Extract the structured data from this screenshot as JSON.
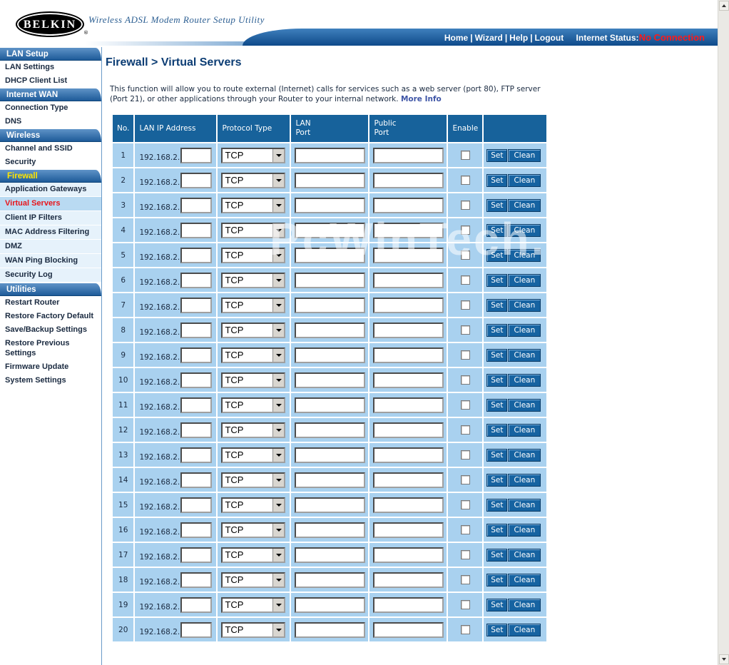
{
  "header": {
    "logo_text": "BELKIN",
    "logo_reg": "®",
    "utility_title": "Wireless ADSL Modem Router Setup Utility",
    "nav": [
      "Home",
      "Wizard",
      "Help",
      "Logout"
    ],
    "nav_separator": "|",
    "status_label": "Internet Status:",
    "status_value": "No Connection",
    "status_color": "#ff1a1a"
  },
  "sidebar": {
    "sections": [
      {
        "title": "LAN Setup",
        "items": [
          "LAN Settings",
          "DHCP Client List"
        ]
      },
      {
        "title": "Internet WAN",
        "items": [
          "Connection Type",
          "DNS"
        ]
      },
      {
        "title": "Wireless",
        "items": [
          "Channel and SSID",
          "Security"
        ]
      },
      {
        "title": "Firewall",
        "items": [
          "Application Gateways",
          "Virtual Servers",
          "Client IP Filters",
          "MAC Address Filtering",
          "DMZ",
          "WAN Ping Blocking",
          "Security Log"
        ]
      },
      {
        "title": "Utilities",
        "items": [
          "Restart Router",
          "Restore Factory Default",
          "Save/Backup Settings",
          "Restore Previous Settings",
          "Firmware Update",
          "System Settings"
        ]
      }
    ],
    "active_section": "Firewall",
    "active_item": "Virtual Servers"
  },
  "main": {
    "title": "Firewall > Virtual Servers",
    "intro": "This function will allow you to route external (Internet) calls for services such as a web server (port 80), FTP server (Port 21), or other applications through your Router to your internal network.",
    "more_info": "More Info",
    "table": {
      "headers": {
        "no": "No.",
        "lan_ip": "LAN IP Address",
        "protocol": "Protocol Type",
        "lan_port_1": "LAN",
        "lan_port_2": "Port",
        "public_port_1": "Public",
        "public_port_2": "Port",
        "enable": "Enable"
      },
      "ip_prefix": "192.168.2.",
      "protocol_default": "TCP",
      "set_label": "Set",
      "clean_label": "Clean",
      "rows": [
        {
          "no": "1",
          "ip": "",
          "protocol": "TCP",
          "lan_port": "",
          "public_port": "",
          "enabled": false
        },
        {
          "no": "2",
          "ip": "",
          "protocol": "TCP",
          "lan_port": "",
          "public_port": "",
          "enabled": false
        },
        {
          "no": "3",
          "ip": "",
          "protocol": "TCP",
          "lan_port": "",
          "public_port": "",
          "enabled": false
        },
        {
          "no": "4",
          "ip": "",
          "protocol": "TCP",
          "lan_port": "",
          "public_port": "",
          "enabled": false
        },
        {
          "no": "5",
          "ip": "",
          "protocol": "TCP",
          "lan_port": "",
          "public_port": "",
          "enabled": false
        },
        {
          "no": "6",
          "ip": "",
          "protocol": "TCP",
          "lan_port": "",
          "public_port": "",
          "enabled": false
        },
        {
          "no": "7",
          "ip": "",
          "protocol": "TCP",
          "lan_port": "",
          "public_port": "",
          "enabled": false
        },
        {
          "no": "8",
          "ip": "",
          "protocol": "TCP",
          "lan_port": "",
          "public_port": "",
          "enabled": false
        },
        {
          "no": "9",
          "ip": "",
          "protocol": "TCP",
          "lan_port": "",
          "public_port": "",
          "enabled": false
        },
        {
          "no": "10",
          "ip": "",
          "protocol": "TCP",
          "lan_port": "",
          "public_port": "",
          "enabled": false
        },
        {
          "no": "11",
          "ip": "",
          "protocol": "TCP",
          "lan_port": "",
          "public_port": "",
          "enabled": false
        },
        {
          "no": "12",
          "ip": "",
          "protocol": "TCP",
          "lan_port": "",
          "public_port": "",
          "enabled": false
        },
        {
          "no": "13",
          "ip": "",
          "protocol": "TCP",
          "lan_port": "",
          "public_port": "",
          "enabled": false
        },
        {
          "no": "14",
          "ip": "",
          "protocol": "TCP",
          "lan_port": "",
          "public_port": "",
          "enabled": false
        },
        {
          "no": "15",
          "ip": "",
          "protocol": "TCP",
          "lan_port": "",
          "public_port": "",
          "enabled": false
        },
        {
          "no": "16",
          "ip": "",
          "protocol": "TCP",
          "lan_port": "",
          "public_port": "",
          "enabled": false
        },
        {
          "no": "17",
          "ip": "",
          "protocol": "TCP",
          "lan_port": "",
          "public_port": "",
          "enabled": false
        },
        {
          "no": "18",
          "ip": "",
          "protocol": "TCP",
          "lan_port": "",
          "public_port": "",
          "enabled": false
        },
        {
          "no": "19",
          "ip": "",
          "protocol": "TCP",
          "lan_port": "",
          "public_port": "",
          "enabled": false
        },
        {
          "no": "20",
          "ip": "",
          "protocol": "TCP",
          "lan_port": "",
          "public_port": "",
          "enabled": false
        }
      ]
    }
  },
  "watermark": "PcWinTech.com",
  "colors": {
    "header_blue": "#17629b",
    "row_blue": "#a9d1ef",
    "title_blue": "#0c3d74",
    "active_item_red": "#e8161c",
    "active_section_yellow": "#ffe600"
  }
}
